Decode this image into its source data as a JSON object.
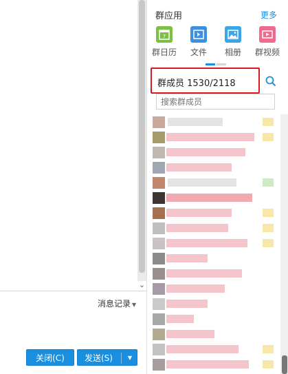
{
  "chat": {
    "history_label": "消息记录",
    "close_label": "关闭(C)",
    "send_label": "发送(S)"
  },
  "side": {
    "title": "群应用",
    "more": "更多",
    "apps": [
      {
        "label": "群日历",
        "icon": "calendar-icon"
      },
      {
        "label": "文件",
        "icon": "file-icon"
      },
      {
        "label": "相册",
        "icon": "photo-album-icon"
      },
      {
        "label": "群视频",
        "icon": "video-icon"
      }
    ],
    "member_header": "群成员 1530/2118",
    "search_placeholder": "搜索群成员"
  },
  "colors": {
    "accent": "#1a8fe0",
    "highlight_border": "#d7191c"
  }
}
